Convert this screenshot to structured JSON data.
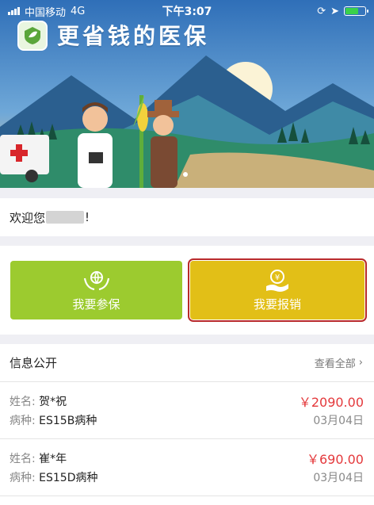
{
  "status": {
    "carrier": "中国移动",
    "network": "4G",
    "time": "下午3:07",
    "battery_level": 0.7
  },
  "banner": {
    "title": "更省钱的医保",
    "logo_icon": "leaf-shield-icon"
  },
  "welcome": {
    "prefix": "欢迎您",
    "suffix": "!"
  },
  "actions": {
    "join": {
      "label": "我要参保",
      "icon": "globe-hands-icon",
      "color": "#9ccb2f"
    },
    "claim": {
      "label": "我要报销",
      "icon": "yuan-hand-icon",
      "color": "#e2bf17"
    }
  },
  "info": {
    "title": "信息公开",
    "view_all": "查看全部",
    "name_label": "姓名:",
    "disease_label": "病种:",
    "records": [
      {
        "name": "贺*祝",
        "disease": "ES15B病种",
        "amount": "￥2090.00",
        "date": "03月04日"
      },
      {
        "name": "崔*年",
        "disease": "ES15D病种",
        "amount": "￥690.00",
        "date": "03月04日"
      }
    ]
  }
}
